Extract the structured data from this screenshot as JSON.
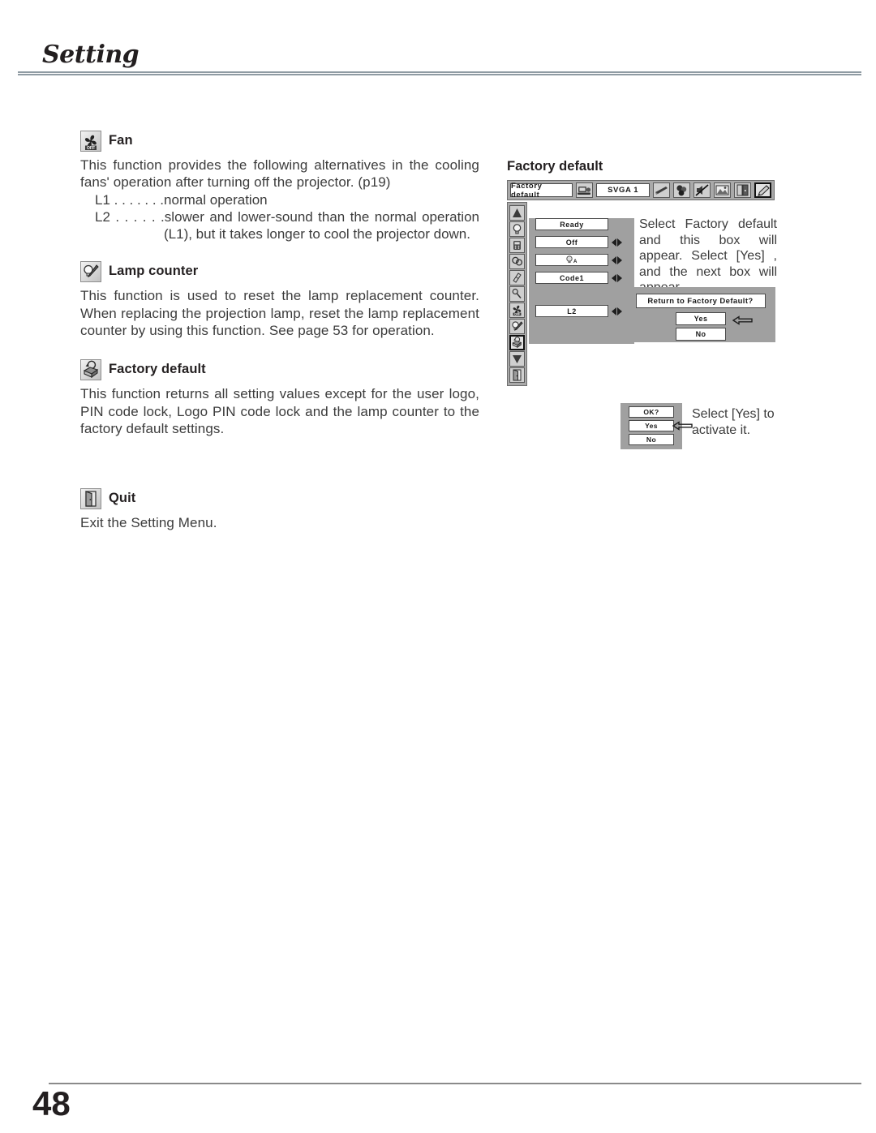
{
  "page": {
    "title": "Setting",
    "number": "48"
  },
  "sections": [
    {
      "id": "fan",
      "icon": "fan-off-icon",
      "heading": "Fan",
      "paragraph": "This function provides the following alternatives in the cooling fans' operation after turning off the projector. (p19)",
      "list": [
        {
          "label": "L1 . . . . . . .",
          "text": "normal operation"
        },
        {
          "label": "L2 . . . . . .",
          "text": "slower and lower-sound than the normal operation (L1), but it takes longer to cool the projector down."
        }
      ]
    },
    {
      "id": "lamp-counter",
      "icon": "lamp-counter-icon",
      "heading": "Lamp counter",
      "paragraph": "This function is used to reset the lamp replacement counter.  When replacing the projection lamp, reset the lamp replacement counter by using this function.  See page 53 for operation."
    },
    {
      "id": "factory-default",
      "icon": "factory-default-icon",
      "heading": "Factory default",
      "paragraph": "This function returns all setting values except for the user logo,  PIN code lock, Logo PIN code lock and the lamp counter to the factory default settings."
    },
    {
      "id": "quit",
      "icon": "quit-door-icon",
      "heading": "Quit",
      "paragraph": "Exit the Setting Menu."
    }
  ],
  "osd": {
    "caption": "Factory default",
    "menubar": {
      "menu_name": "Factory default",
      "source": "SVGA 1",
      "source_icon": "computer-source-icon",
      "icons": [
        "screen-icon",
        "color-adjust-icon",
        "sound-mute-icon",
        "image-icon",
        "pc-adjust-icon",
        "setting-pencil-icon"
      ],
      "selected_icon_index": 5
    },
    "sidebar_icons": [
      "keystone-icon",
      "lamp-mode-icon",
      "remote-control-icon",
      "standby-icon",
      "eraser-icon",
      "pointer-icon",
      "fan-off-icon",
      "lamp-counter-icon",
      "factory-default-icon",
      "down-arrow-icon",
      "quit-door-icon"
    ],
    "selected_sidebar_index": 8,
    "rows": [
      {
        "value": "Ready",
        "arrows": false
      },
      {
        "value": "Off",
        "arrows": true
      },
      {
        "value": "A",
        "arrows": true,
        "icon": "lamp-a-icon"
      },
      {
        "value": "Code1",
        "arrows": true
      },
      {
        "value": "L2",
        "arrows": true
      }
    ],
    "note_1": "Select Factory default and this box will appear.  Select [Yes] , and the next box will appear.",
    "dialog_1": {
      "title": "Return to Factory Default?",
      "yes": "Yes",
      "no": "No",
      "cursor": "left-arrow-cursor-icon"
    },
    "dialog_2": {
      "title": "OK?",
      "yes": "Yes",
      "no": "No",
      "cursor": "left-arrow-cursor-icon"
    },
    "note_2": "Select [Yes] to activate it."
  },
  "colors": {
    "osd_gray": "#a9a9a9",
    "osd_panel_gray": "#a0a0a0",
    "text": "#3c3c3c",
    "rule": "#8f9ba3"
  }
}
